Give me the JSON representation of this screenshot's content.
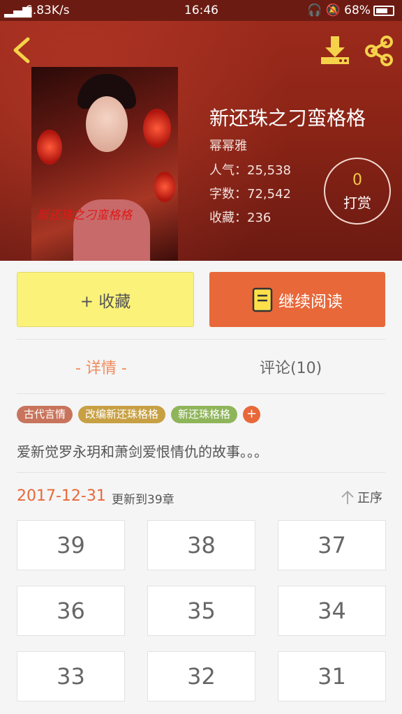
{
  "status_bar": {
    "signal": "⁴ᴳ",
    "speed": "6.83K/s",
    "dots": "···",
    "time": "16:46",
    "battery": "68%"
  },
  "book": {
    "title": "新还珠之刁蛮格格",
    "author": "幂幂雅",
    "popularity_label": "人气：",
    "popularity": "25,538",
    "words_label": "字数：",
    "words": "72,542",
    "favorites_label": "收藏：",
    "favorites": "236",
    "cover_text": "新还珠之刁蛮格格"
  },
  "tip": {
    "count": "0",
    "label": "打赏"
  },
  "actions": {
    "favorite": "+ 收藏",
    "continue_reading": "继续阅读"
  },
  "tabs": {
    "details": "- 详情 -",
    "comments": "评论(10)"
  },
  "tags": [
    {
      "label": "古代言情",
      "color": "#c8745c"
    },
    {
      "label": "改编新还珠格格",
      "color": "#c8a044"
    },
    {
      "label": "新还珠格格",
      "color": "#8fb55a"
    }
  ],
  "tag_add": "+",
  "description": "爱新觉罗永玥和萧剑爱恨情仇的故事。。。",
  "update": {
    "date": "2017-12-31",
    "text": "更新到39章",
    "sort_label": "正序"
  },
  "chapters": [
    "39",
    "38",
    "37",
    "36",
    "35",
    "34",
    "33",
    "32",
    "31"
  ],
  "colors": {
    "accent": "#e8683a",
    "favorite_bg": "#fbf27a",
    "tab_active": "#f08a5d",
    "tip_number": "#f5c845"
  }
}
